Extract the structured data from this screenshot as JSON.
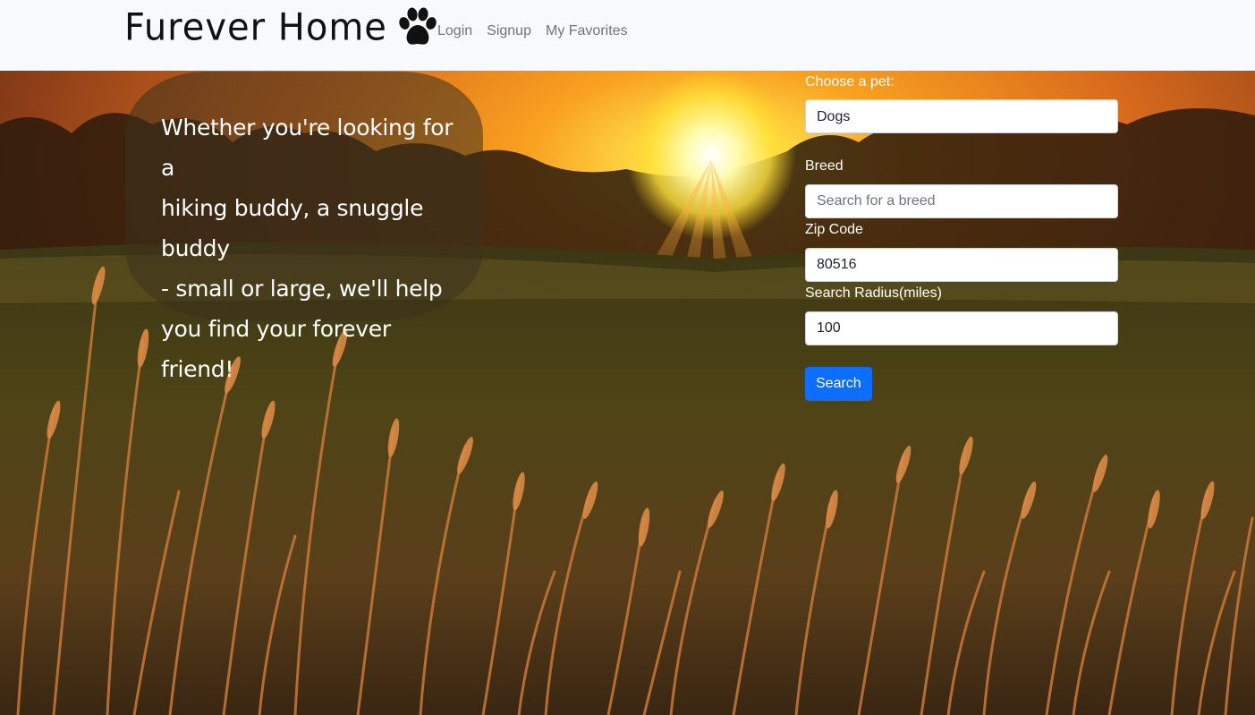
{
  "nav": {
    "brand": "Furever Home",
    "links": [
      "Login",
      "Signup",
      "My Favorites"
    ]
  },
  "hero": {
    "tagline_lines": [
      "Whether you're looking for a",
      "hiking buddy, a snuggle buddy",
      "- small or large, we'll help",
      "you find your forever friend!"
    ]
  },
  "form": {
    "pet_label": "Choose a pet:",
    "pet_value": "Dogs",
    "breed_label": "Breed",
    "breed_placeholder": "Search for a breed",
    "zip_label": "Zip Code",
    "zip_value": "80516",
    "radius_label": "Search Radius(miles)",
    "radius_value": "100",
    "search_button": "Search"
  },
  "colors": {
    "navbar_bg": "#f8f9fa",
    "primary": "#0d6efd",
    "nav_link": "#6c757d"
  }
}
